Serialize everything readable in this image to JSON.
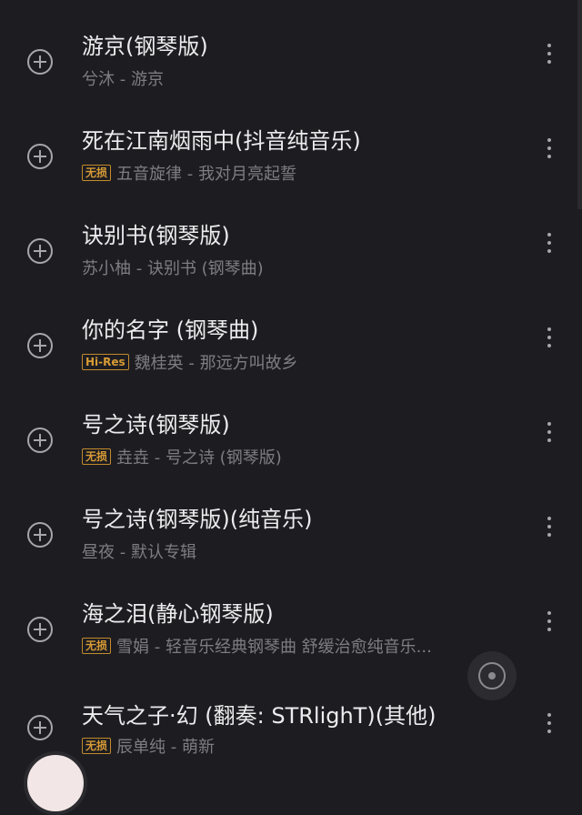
{
  "songs": [
    {
      "title": "游京(钢琴版)",
      "badge": "",
      "subtitle": "兮沐 - 游京"
    },
    {
      "title": "死在江南烟雨中(抖音纯音乐)",
      "badge": "无损",
      "subtitle": "五音旋律 - 我对月亮起誓"
    },
    {
      "title": "诀别书(钢琴版)",
      "badge": "",
      "subtitle": "苏小柚 - 诀别书 (钢琴曲)"
    },
    {
      "title": "你的名字 (钢琴曲)",
      "badge": "Hi-Res",
      "subtitle": "魏桂英 - 那远方叫故乡"
    },
    {
      "title": "号之诗(钢琴版)",
      "badge": "无损",
      "subtitle": "垚垚 - 号之诗 (钢琴版)"
    },
    {
      "title": "号之诗(钢琴版)(纯音乐)",
      "badge": "",
      "subtitle": "昼夜 - 默认专辑"
    },
    {
      "title": "海之泪(静心钢琴版)",
      "badge": "无损",
      "subtitle": "雪娟 - 轻音乐经典钢琴曲 舒缓治愈纯音乐..."
    },
    {
      "title": "天气之子·幻 (翻奏: STRlighT)(其他)",
      "badge": "无损",
      "subtitle": "辰单纯 - 萌新"
    }
  ],
  "icons": {
    "add": "plus-circle-icon",
    "more": "more-vertical-icon",
    "fab": "locate-icon"
  },
  "colors": {
    "background": "#1d1d21",
    "badge": "#d89b36"
  }
}
